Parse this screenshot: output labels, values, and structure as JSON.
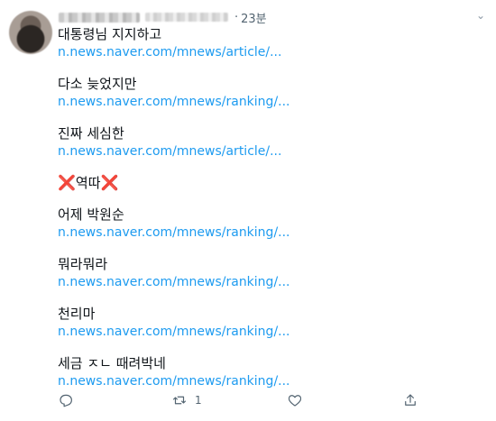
{
  "tweet": {
    "time": "23분",
    "dot": "·",
    "lines": [
      {
        "text": "대통령님 지지하고",
        "link": "n.news.naver.com/mnews/article/..."
      },
      {
        "text": "다소 늦었지만",
        "link": "n.news.naver.com/mnews/ranking/..."
      },
      {
        "text": "진짜 세심한",
        "link": "n.news.naver.com/mnews/article/..."
      },
      {
        "text_x1": "❌",
        "text_mid": "역따",
        "text_x2": "❌"
      },
      {
        "text": "어제 박원순",
        "link": "n.news.naver.com/mnews/ranking/..."
      },
      {
        "text": "뭐라뭐라",
        "link": "n.news.naver.com/mnews/ranking/..."
      },
      {
        "text": "천리마",
        "link": "n.news.naver.com/mnews/ranking/..."
      },
      {
        "text": "세금 ㅈㄴ 때려박네",
        "link": "n.news.naver.com/mnews/ranking/..."
      }
    ]
  },
  "actions": {
    "reply_icon": "reply-icon",
    "retweet_icon": "retweet-icon",
    "retweet_count": "1",
    "like_icon": "heart-icon",
    "share_icon": "share-icon"
  },
  "colors": {
    "link": "#1d9bf0",
    "text": "#0f1419",
    "muted": "#536471",
    "x_emoji": "#dd2e44"
  }
}
